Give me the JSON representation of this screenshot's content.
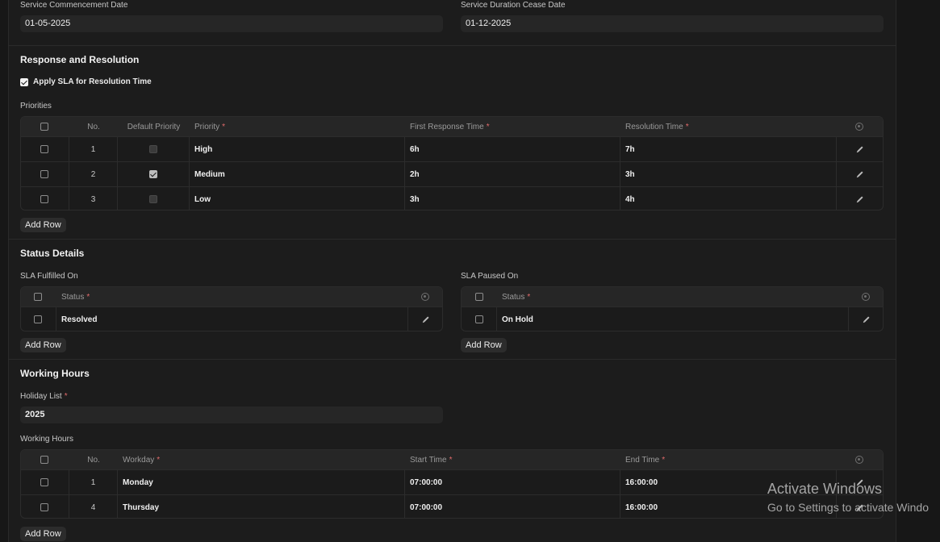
{
  "service": {
    "commencement_label": "Service Commencement Date",
    "commencement_value": "01-05-2025",
    "cease_label": "Service Duration Cease Date",
    "cease_value": "01-12-2025"
  },
  "response": {
    "title": "Response and Resolution",
    "apply_sla_label": "Apply SLA for Resolution Time",
    "apply_sla_checked": true,
    "priorities_label": "Priorities",
    "columns": {
      "no": "No.",
      "default_priority": "Default Priority",
      "priority": "Priority",
      "first_response": "First Response Time",
      "resolution": "Resolution Time"
    },
    "rows": [
      {
        "no": "1",
        "default": false,
        "priority": "High",
        "first_response": "6h",
        "resolution": "7h"
      },
      {
        "no": "2",
        "default": true,
        "priority": "Medium",
        "first_response": "2h",
        "resolution": "3h"
      },
      {
        "no": "3",
        "default": false,
        "priority": "Low",
        "first_response": "3h",
        "resolution": "4h"
      }
    ],
    "add_row": "Add Row"
  },
  "status": {
    "title": "Status Details",
    "fulfilled_label": "SLA Fulfilled On",
    "paused_label": "SLA Paused On",
    "status_col": "Status",
    "fulfilled_value": "Resolved",
    "paused_value": "On Hold",
    "add_row": "Add Row"
  },
  "working": {
    "title": "Working Hours",
    "holiday_label": "Holiday List",
    "holiday_value": "2025",
    "hours_label": "Working Hours",
    "columns": {
      "no": "No.",
      "workday": "Workday",
      "start": "Start Time",
      "end": "End Time"
    },
    "rows": [
      {
        "no": "1",
        "workday": "Monday",
        "start": "07:00:00",
        "end": "16:00:00"
      },
      {
        "no": "4",
        "workday": "Thursday",
        "start": "07:00:00",
        "end": "16:00:00"
      }
    ],
    "add_row": "Add Row"
  },
  "required_marker": "*",
  "watermark": {
    "line1": "Activate Windows",
    "line2": "Go to Settings to activate Windo"
  }
}
